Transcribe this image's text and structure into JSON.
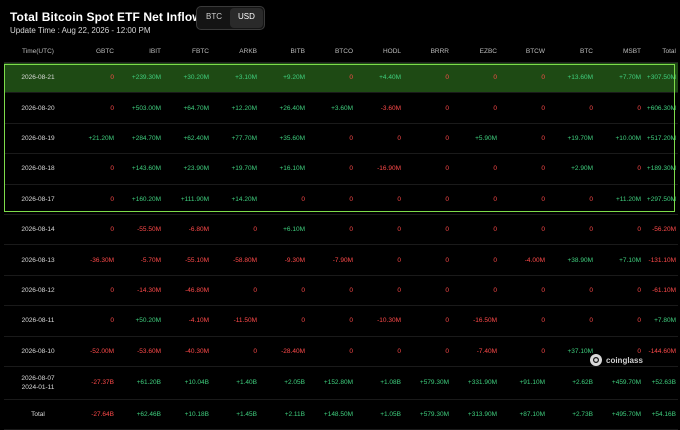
{
  "header": {
    "title": "Total Bitcoin Spot ETF Net Inflow (USD)",
    "currency_options": [
      "BTC",
      "USD"
    ],
    "selected_currency": "USD",
    "update_time": "Update Time : Aug 22, 2026 - 12:00 PM"
  },
  "table": {
    "columns": [
      "Time(UTC)",
      "GBTC",
      "IBIT",
      "FBTC",
      "ARKB",
      "BITB",
      "BTCO",
      "HODL",
      "BRRR",
      "EZBC",
      "BTCW",
      "BTC",
      "MSBT",
      "Total"
    ],
    "rows": [
      {
        "date": "2026-08-21",
        "values": [
          "0",
          "+239.30M",
          "+30.20M",
          "+3.10M",
          "+9.20M",
          "0",
          "+4.40M",
          "0",
          "0",
          "0",
          "+13.60M",
          "+7.70M",
          "+307.50M"
        ]
      },
      {
        "date": "2026-08-20",
        "values": [
          "0",
          "+503.00M",
          "+64.70M",
          "+12.20M",
          "+26.40M",
          "+3.60M",
          "-3.60M",
          "0",
          "0",
          "0",
          "0",
          "0",
          "+606.30M"
        ]
      },
      {
        "date": "2026-08-19",
        "values": [
          "+21.20M",
          "+284.70M",
          "+62.40M",
          "+77.70M",
          "+35.60M",
          "0",
          "0",
          "0",
          "+5.90M",
          "0",
          "+19.70M",
          "+10.00M",
          "+517.20M"
        ]
      },
      {
        "date": "2026-08-18",
        "values": [
          "0",
          "+143.60M",
          "+23.90M",
          "+19.70M",
          "+16.10M",
          "0",
          "-16.90M",
          "0",
          "0",
          "0",
          "+2.90M",
          "0",
          "+189.30M"
        ]
      },
      {
        "date": "2026-08-17",
        "values": [
          "0",
          "+160.20M",
          "+111.90M",
          "+14.20M",
          "0",
          "0",
          "0",
          "0",
          "0",
          "0",
          "0",
          "+11.20M",
          "+297.50M"
        ]
      },
      {
        "date": "2026-08-14",
        "values": [
          "0",
          "-55.50M",
          "-6.80M",
          "0",
          "+6.10M",
          "0",
          "0",
          "0",
          "0",
          "0",
          "0",
          "0",
          "-56.20M"
        ]
      },
      {
        "date": "2026-08-13",
        "values": [
          "-36.30M",
          "-5.70M",
          "-55.10M",
          "-58.80M",
          "-9.30M",
          "-7.90M",
          "0",
          "0",
          "0",
          "-4.00M",
          "+38.90M",
          "+7.10M",
          "-131.10M"
        ]
      },
      {
        "date": "2026-08-12",
        "values": [
          "0",
          "-14.30M",
          "-46.80M",
          "0",
          "0",
          "0",
          "0",
          "0",
          "0",
          "0",
          "0",
          "0",
          "-61.10M"
        ]
      },
      {
        "date": "2026-08-11",
        "values": [
          "0",
          "+50.20M",
          "-4.10M",
          "-11.50M",
          "0",
          "0",
          "-10.30M",
          "0",
          "-16.50M",
          "0",
          "0",
          "0",
          "+7.80M"
        ]
      },
      {
        "date": "2026-08-10",
        "values": [
          "-52.00M",
          "-53.60M",
          "-40.30M",
          "0",
          "-28.40M",
          "0",
          "0",
          "0",
          "-7.40M",
          "0",
          "+37.10M",
          "0",
          "-144.60M"
        ]
      },
      {
        "date": "2026-08-07",
        "date2": "2024-01-11",
        "values": [
          "-27.37B",
          "+61.20B",
          "+10.04B",
          "+1.40B",
          "+2.05B",
          "+152.80M",
          "+1.08B",
          "+579.30M",
          "+331.90M",
          "+91.10M",
          "+2.62B",
          "+459.70M",
          "+52.63B"
        ]
      },
      {
        "date": "Total",
        "values": [
          "-27.64B",
          "+62.46B",
          "+10.18B",
          "+1.45B",
          "+2.11B",
          "+148.50M",
          "+1.05B",
          "+579.30M",
          "+313.90M",
          "+87.10M",
          "+2.73B",
          "+495.70M",
          "+54.16B"
        ]
      }
    ]
  },
  "watermark": {
    "text": "coinglass",
    "icon": "coinglass-logo-icon"
  },
  "colors": {
    "positive": "#3fcf7e",
    "negative": "#ff4a4a",
    "highlight_border": "#7ddc4a",
    "top_row_bg": "#1e4a14"
  }
}
